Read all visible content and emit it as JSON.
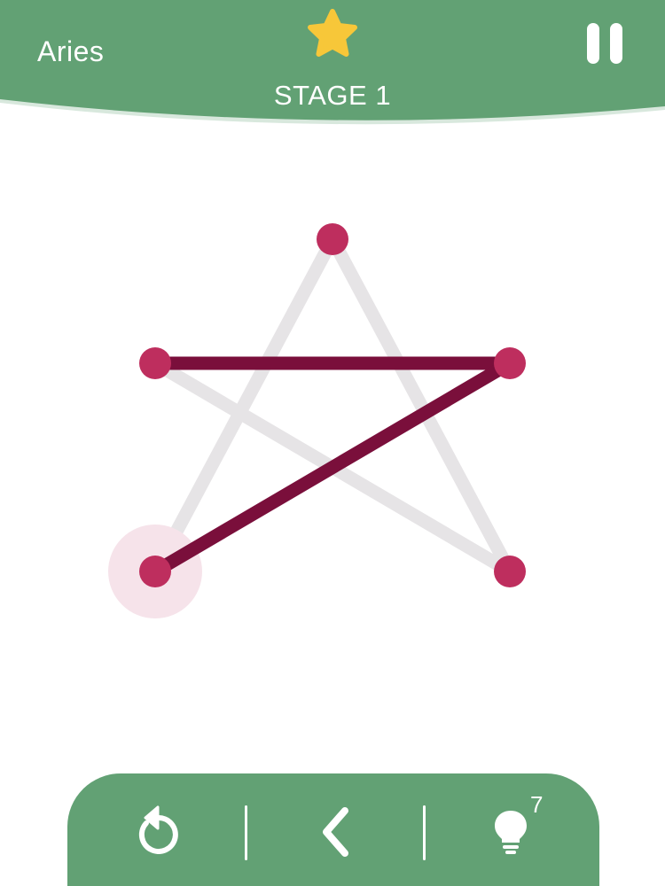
{
  "header": {
    "pack_name": "Aries",
    "stage_title": "STAGE 1",
    "star_icon": "star-icon",
    "pause_icon": "pause-icon"
  },
  "puzzle": {
    "total_nodes": 5,
    "total_edges": 5,
    "edges_drawn": 2,
    "current_node": "bottom-left"
  },
  "toolbar": {
    "restart_icon": "restart-icon",
    "back_icon": "back-icon",
    "hint_icon": "lightbulb-icon",
    "hint_count": "7"
  },
  "colors": {
    "header_green": "#62a174",
    "node": "#be2e5e",
    "drawn_line": "#7a0f3b",
    "guide_line": "#e6e4e6",
    "star": "#f7c739",
    "active_halo": "#f6e3ea"
  }
}
